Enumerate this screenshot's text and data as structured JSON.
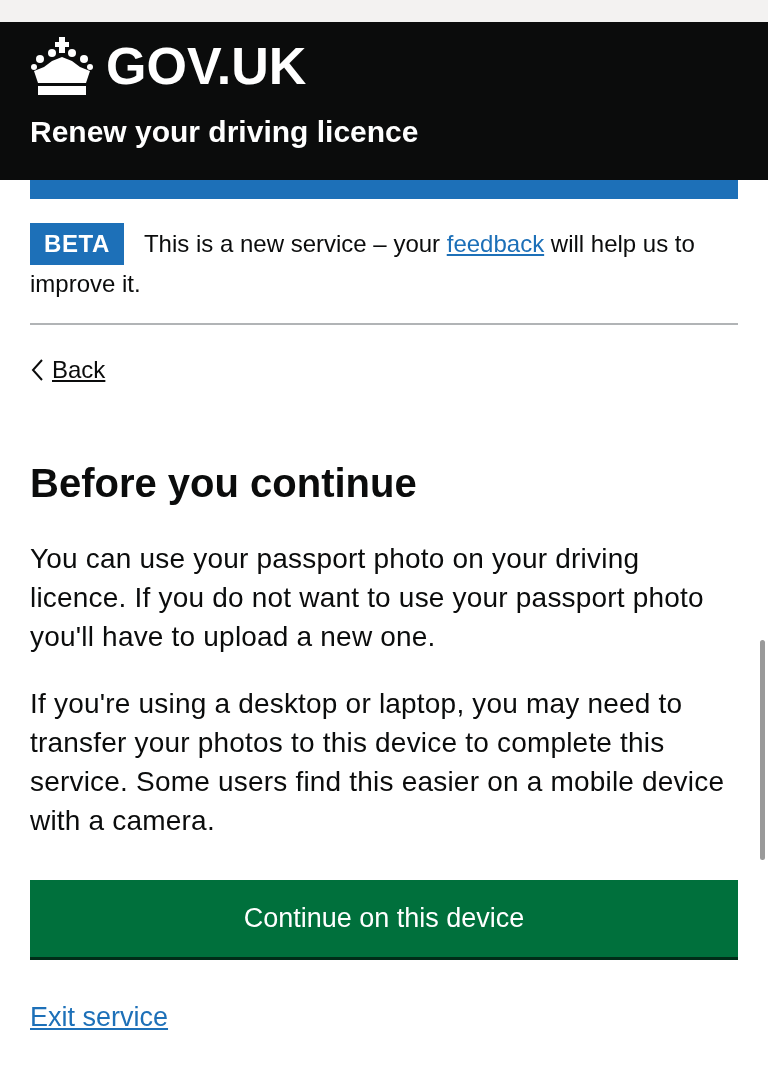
{
  "header": {
    "logo_text": "GOV.UK",
    "service_name": "Renew your driving licence"
  },
  "phase_banner": {
    "tag": "BETA",
    "text_before": "This is a new service – your ",
    "link": "feedback",
    "text_after": " will help us to improve it."
  },
  "back_link": "Back",
  "heading": "Before you continue",
  "paragraphs": [
    "You can use your passport photo on your driving licence. If you do not want to use your passport photo you'll have to upload a new one.",
    "If you're using a desktop or laptop, you may need to transfer your photos to this device to complete this service. Some users find this easier on a mobile device with a camera."
  ],
  "primary_button": "Continue on this device",
  "exit_link": "Exit service"
}
